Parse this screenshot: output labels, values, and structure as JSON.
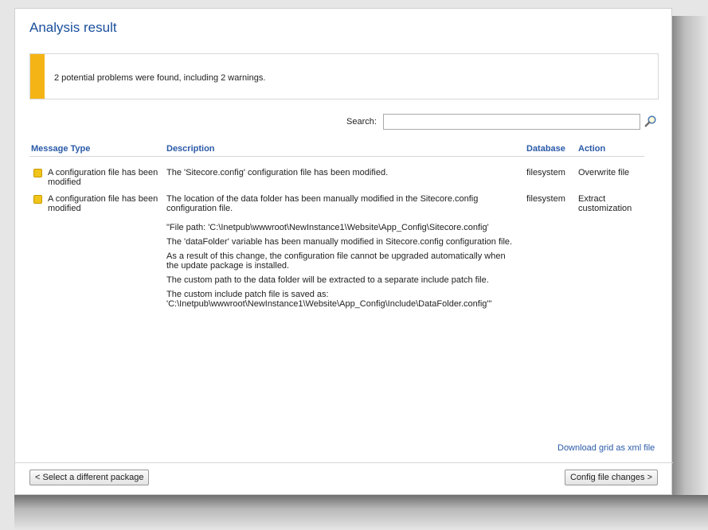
{
  "title": "Analysis result",
  "alert": {
    "message": "2 potential problems were found, including 2 warnings.",
    "color": "#f5b416"
  },
  "search": {
    "label": "Search:",
    "value": ""
  },
  "columns": {
    "type": "Message Type",
    "description": "Description",
    "database": "Database",
    "action": "Action"
  },
  "rows": [
    {
      "type": "A configuration file has been modified",
      "description": "The 'Sitecore.config' configuration file has been modified.",
      "database": "filesystem",
      "action": "Overwrite file"
    },
    {
      "type": "A configuration file has been modified",
      "description": "The location of the data folder has been manually modified in the Sitecore.config configuration file.",
      "details": [
        "\"File path: 'C:\\Inetpub\\wwwroot\\NewInstance1\\Website\\App_Config\\Sitecore.config'",
        "The 'dataFolder' variable has been manually modified in Sitecore.config configuration file.",
        "As a result of this change, the configuration file cannot be upgraded automatically when the update package is installed.",
        "The custom path to the data folder will be extracted to a separate include patch file.",
        "The custom include patch file is saved as: 'C:\\Inetpub\\wwwroot\\NewInstance1\\Website\\App_Config\\Include\\DataFolder.config'\""
      ],
      "database": "filesystem",
      "action": "Extract customization"
    }
  ],
  "download_link": "Download grid as xml file",
  "buttons": {
    "back": "< Select a different package",
    "next": "Config file changes >"
  },
  "colors": {
    "title": "#1a4f9c",
    "header": "#2a5aa8",
    "warning_icon": "#f0c419"
  }
}
